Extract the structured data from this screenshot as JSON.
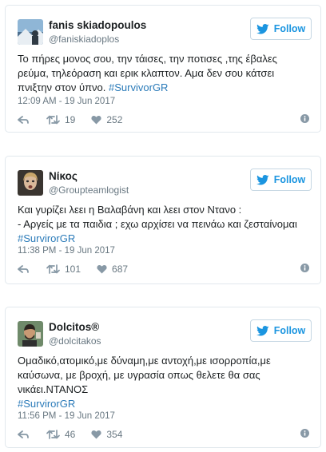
{
  "follow_label": "Follow",
  "tweets": [
    {
      "name": "fanis skiadopoulos",
      "handle": "@faniskiadoplos",
      "text": "Το πήρες μονος σου, την τάισες, την ποτισες ,της έβαλες ρεύμα, τηλεόραση και ερικ κλαπτον. Αμα δεν σου κάτσει πνιξτην στον ύπνο.",
      "hashtag": "#SurvivorGR",
      "time": "12:09 AM - 19 Jun 2017",
      "retweets": "19",
      "likes": "252"
    },
    {
      "name": "Νίκος",
      "handle": "@Groupteamlogist",
      "text": "Και γυρίζει λεει η Βαλαβάνη και λεει στον Ντανο :\n- Αργείς με τα παιδια ; εχω αρχίσει να πεινάω και ζεσταίνομαι",
      "hashtag": "#SurvirorGR",
      "time": "11:38 PM - 19 Jun 2017",
      "retweets": "101",
      "likes": "687"
    },
    {
      "name": "Dolcitos®",
      "handle": "@dolcitakos",
      "text": "Ομαδικό,ατομικό,με δύναμη,με αντοχή,με ισορροπία,με καύσωνα, με βροχή, με υγρασία οπως θελετε θα σας νικάει.ΝΤΑΝΟΣ",
      "hashtag": "#SurvirorGR",
      "time": "11:56 PM - 19 Jun 2017",
      "retweets": "46",
      "likes": "354"
    }
  ],
  "colors": {
    "accent": "#1b95e0",
    "hashtag": "#2b7bb9",
    "muted": "#697882",
    "text": "#1c2022",
    "border": "#e1e8ed"
  }
}
